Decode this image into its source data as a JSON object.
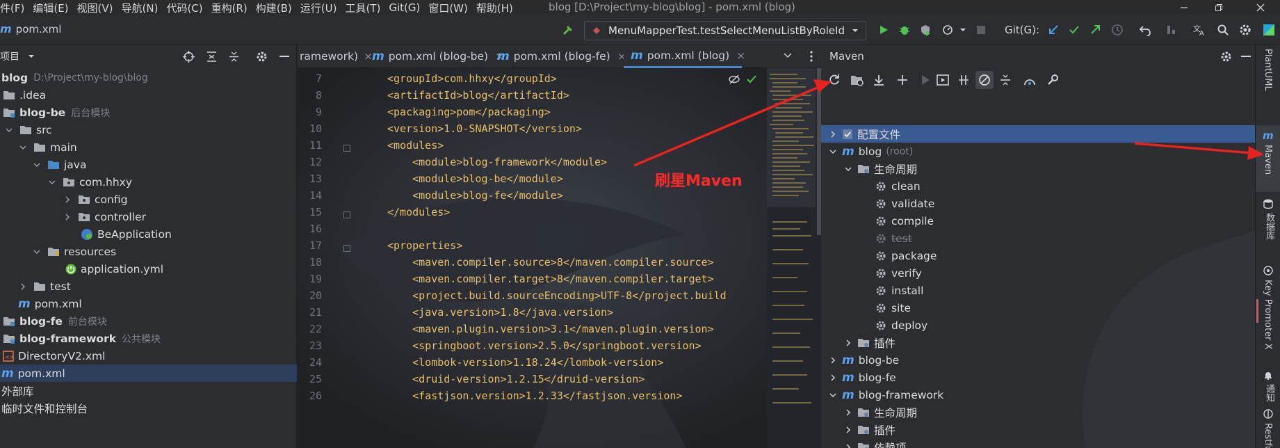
{
  "menu": [
    "件(F)",
    "编辑(E)",
    "视图(V)",
    "导航(N)",
    "代码(C)",
    "重构(R)",
    "构建(B)",
    "运行(U)",
    "工具(T)",
    "Git(G)",
    "窗口(W)",
    "帮助(H)"
  ],
  "window_title": "blog [D:\\Project\\my-blog\\blog] - pom.xml (blog)",
  "breadcrumb_file": "pom.xml",
  "run_config": "MenuMapperTest.testSelectMenuListByRoleId",
  "git_label": "Git(G):",
  "project": {
    "header_label": "项目",
    "rows": [
      {
        "label": "blog",
        "hint": "D:\\Project\\my-blog\\blog"
      },
      {
        "label": ".idea",
        "hint": ""
      },
      {
        "label": "blog-be",
        "hint": "后台模块"
      },
      {
        "label": "src",
        "hint": ""
      },
      {
        "label": "main",
        "hint": ""
      },
      {
        "label": "java",
        "hint": ""
      },
      {
        "label": "com.hhxy",
        "hint": ""
      },
      {
        "label": "config",
        "hint": ""
      },
      {
        "label": "controller",
        "hint": ""
      },
      {
        "label": "BeApplication",
        "hint": ""
      },
      {
        "label": "resources",
        "hint": ""
      },
      {
        "label": "application.yml",
        "hint": ""
      },
      {
        "label": "test",
        "hint": ""
      },
      {
        "label": "pom.xml",
        "hint": ""
      },
      {
        "label": "blog-fe",
        "hint": "前台模块"
      },
      {
        "label": "blog-framework",
        "hint": "公共模块"
      },
      {
        "label": "DirectoryV2.xml",
        "hint": ""
      },
      {
        "label": "pom.xml",
        "hint": ""
      },
      {
        "label": "外部库",
        "hint": ""
      },
      {
        "label": "临时文件和控制台",
        "hint": ""
      }
    ]
  },
  "editor": {
    "tabs": [
      "ramework)",
      "pom.xml (blog-be)",
      "pom.xml (blog-fe)",
      "pom.xml (blog)"
    ],
    "lines": [
      {
        "n": "7",
        "t": "<groupId>com.hhxy</groupId>"
      },
      {
        "n": "8",
        "t": "<artifactId>blog</artifactId>"
      },
      {
        "n": "9",
        "t": "<packaging>pom</packaging>"
      },
      {
        "n": "10",
        "t": "<version>1.0-SNAPSHOT</version>"
      },
      {
        "n": "11",
        "t": "<modules>"
      },
      {
        "n": "12",
        "t": "    <module>blog-framework</module>"
      },
      {
        "n": "13",
        "t": "    <module>blog-be</module>"
      },
      {
        "n": "14",
        "t": "    <module>blog-fe</module>"
      },
      {
        "n": "15",
        "t": "</modules>"
      },
      {
        "n": "16",
        "t": ""
      },
      {
        "n": "17",
        "t": "<properties>"
      },
      {
        "n": "18",
        "t": "    <maven.compiler.source>8</maven.compiler.source>"
      },
      {
        "n": "19",
        "t": "    <maven.compiler.target>8</maven.compiler.target>"
      },
      {
        "n": "20",
        "t": "    <project.build.sourceEncoding>UTF-8</project.build"
      },
      {
        "n": "21",
        "t": "    <java.version>1.8</java.version>"
      },
      {
        "n": "22",
        "t": "    <maven.plugin.version>3.1</maven.plugin.version>"
      },
      {
        "n": "23",
        "t": "    <springboot.version>2.5.0</springboot.version>"
      },
      {
        "n": "24",
        "t": "    <lombok-version>1.18.24</lombok-version>"
      },
      {
        "n": "25",
        "t": "    <druid-version>1.2.15</druid-version>"
      },
      {
        "n": "26",
        "t": "    <fastjson.version>1.2.33</fastjson.version>"
      }
    ]
  },
  "maven": {
    "title": "Maven",
    "rows": [
      {
        "label": "配置文件",
        "hint": ""
      },
      {
        "label": "blog",
        "hint": "(root)"
      },
      {
        "label": "生命周期",
        "hint": ""
      },
      {
        "label": "clean",
        "hint": ""
      },
      {
        "label": "validate",
        "hint": ""
      },
      {
        "label": "compile",
        "hint": ""
      },
      {
        "label": "test",
        "hint": ""
      },
      {
        "label": "package",
        "hint": ""
      },
      {
        "label": "verify",
        "hint": ""
      },
      {
        "label": "install",
        "hint": ""
      },
      {
        "label": "site",
        "hint": ""
      },
      {
        "label": "deploy",
        "hint": ""
      },
      {
        "label": "插件",
        "hint": ""
      },
      {
        "label": "blog-be",
        "hint": ""
      },
      {
        "label": "blog-fe",
        "hint": ""
      },
      {
        "label": "blog-framework",
        "hint": ""
      },
      {
        "label": "生命周期",
        "hint": ""
      },
      {
        "label": "插件",
        "hint": ""
      },
      {
        "label": "依赖项",
        "hint": ""
      }
    ]
  },
  "right_strip": [
    "PlantUML",
    "Maven",
    "数据库",
    "Key Promoter X",
    "通知",
    "Restful"
  ],
  "annotation": "刷星Maven",
  "colors": {
    "accent": "#4a88c7",
    "annotation": "#ff2a2a",
    "selection": "#2e3f5c",
    "maven_selection": "#3a5a92"
  }
}
